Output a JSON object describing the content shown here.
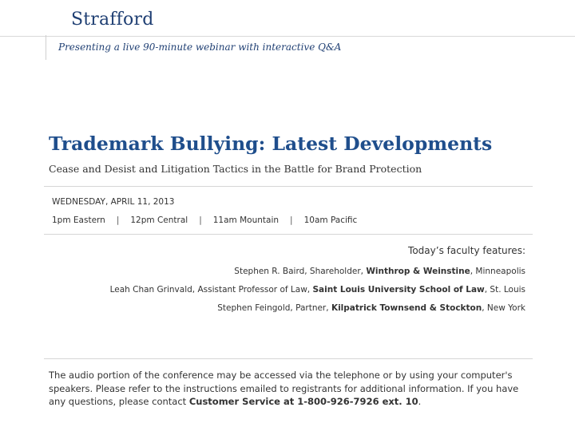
{
  "header": {
    "logo": "Strafford",
    "tagline": "Presenting a live 90-minute webinar with interactive Q&A"
  },
  "event": {
    "title": "Trademark Bullying: Latest Developments",
    "subtitle": "Cease and Desist and Litigation Tactics in the Battle for Brand Protection",
    "date": "WEDNESDAY, APRIL 11, 2013",
    "times": [
      "1pm Eastern",
      "12pm Central",
      "11am Mountain",
      "10am Pacific"
    ],
    "separator": "|"
  },
  "faculty": {
    "heading": "Today’s faculty features:",
    "members": [
      {
        "name_role": "Stephen R. Baird, Shareholder, ",
        "org": "Winthrop & Weinstine",
        "location": ", Minneapolis"
      },
      {
        "name_role": "Leah Chan Grinvald, Assistant Professor of Law, ",
        "org": "Saint Louis University School of Law",
        "location": ", St. Louis"
      },
      {
        "name_role": "Stephen Feingold, Partner, ",
        "org": "Kilpatrick Townsend & Stockton",
        "location": ", New York"
      }
    ]
  },
  "footer": {
    "text": "The audio portion of the conference may be accessed via the telephone or by using your computer's speakers. Please refer to the instructions emailed to registrants for additional information.  If you have any questions, please contact ",
    "contact": "Customer Service at 1-800-926-7926 ext. 10",
    "end": "."
  },
  "colors": {
    "brand_blue": "#1f3f73",
    "title_blue": "#1f4e8c"
  }
}
